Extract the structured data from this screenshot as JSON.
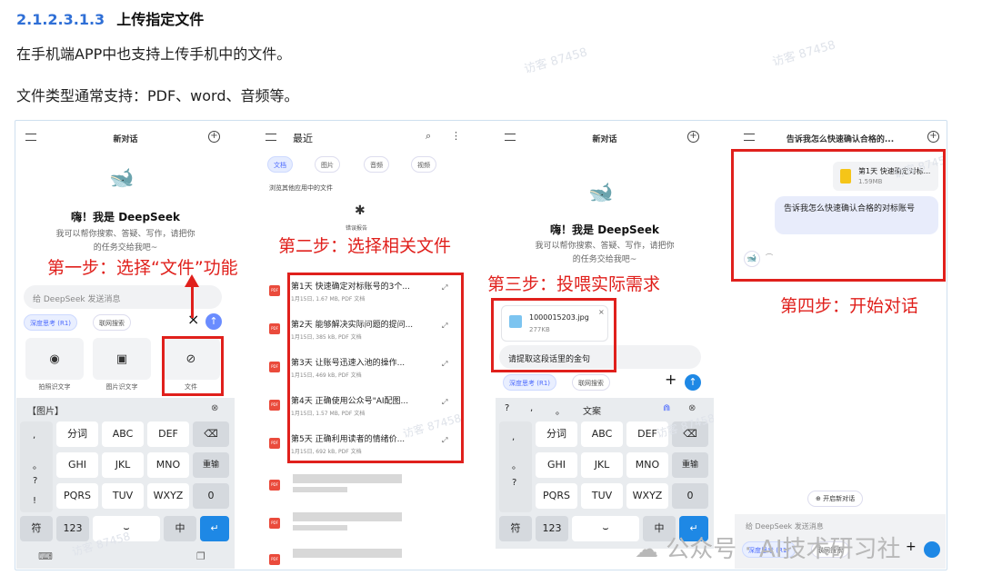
{
  "section": {
    "number": "2.1.2.3.1.3",
    "title": "上传指定文件",
    "para1": "在手机端APP中也支持上传手机中的文件。",
    "para2": "文件类型通常支持：PDF、word、音频等。"
  },
  "watermark": "访客 87458",
  "screen1": {
    "title": "新对话",
    "greeting": "嗨！我是 DeepSeek",
    "sub1": "我可以帮你搜索、答疑、写作，请把你",
    "sub2": "的任务交给我吧~",
    "input_placeholder": "给 DeepSeek 发送消息",
    "chip_think": "深度思考 (R1)",
    "chip_search": "联网搜索",
    "close": "×",
    "tiles": [
      {
        "icon": "camera-icon",
        "glyph": "◉",
        "label": "拍照识文字"
      },
      {
        "icon": "image-icon",
        "glyph": "▣",
        "label": "图片识文字"
      },
      {
        "icon": "paperclip-icon",
        "glyph": "⊘",
        "label": "文件"
      }
    ],
    "kb_top": "【图片】",
    "kb_rows": [
      [
        ",",
        "分词",
        "ABC",
        "DEF",
        "⌫"
      ],
      [
        "。",
        "GHI",
        "JKL",
        "MNO",
        "重输"
      ],
      [
        "?",
        "PQRS",
        "TUV",
        "WXYZ",
        "0"
      ],
      [
        "!",
        "",
        "",
        "",
        ""
      ]
    ],
    "kb_bottom": [
      "符",
      "123",
      "⌣",
      "中",
      "↵"
    ],
    "step": "第一步：选择“文件”功能"
  },
  "screen2": {
    "title": "最近",
    "tabs": [
      "文档",
      "图片",
      "音频",
      "视频"
    ],
    "section_label": "浏览其他应用中的文件",
    "bug_label": "错误报告",
    "files": [
      {
        "name": "第1天 快速确定对标账号的3个...",
        "meta": "1月15日, 1.67 MB, PDF 文档"
      },
      {
        "name": "第2天 能够解决实际问题的提问...",
        "meta": "1月15日, 385 kB, PDF 文档"
      },
      {
        "name": "第3天 让账号迅速入池的操作...",
        "meta": "1月15日, 469 kB, PDF 文档"
      },
      {
        "name": "第4天  正确使用公众号\"AI配图...",
        "meta": "1月15日, 1.57 MB, PDF 文档"
      },
      {
        "name": "第5天  正确利用读者的情绪价...",
        "meta": "1月15日, 692 kB, PDF 文档"
      }
    ],
    "step": "第二步：选择相关文件"
  },
  "screen3": {
    "title": "新对话",
    "greeting": "嗨！我是 DeepSeek",
    "sub1": "我可以帮你搜索、答疑、写作，请把你",
    "sub2": "的任务交给我吧~",
    "file_name": "1000015203.jpg",
    "file_size": "277KB",
    "prompt": "请提取这段话里的金句",
    "chip_think": "深度思考 (R1)",
    "chip_search": "联网搜索",
    "kb_top_left": [
      "?",
      ",",
      "。"
    ],
    "kb_top_mid": "文案",
    "kb_rows": [
      [
        ",",
        "分词",
        "ABC",
        "DEF",
        "⌫"
      ],
      [
        "。",
        "GHI",
        "JKL",
        "MNO",
        "重输"
      ],
      [
        "?",
        "PQRS",
        "TUV",
        "WXYZ",
        "0"
      ]
    ],
    "kb_bottom": [
      "符",
      "123",
      "⌣",
      "中",
      "↵"
    ],
    "step": "第三步：投喂实际需求"
  },
  "screen4": {
    "title": "告诉我怎么快速确认合格的...",
    "file_name": "第1天 快速确定对标...",
    "file_size": "1.59MB",
    "message": "告诉我怎么快速确认合格的对标账号",
    "new_chat": "开启新对话",
    "input_placeholder": "给 DeepSeek 发送消息",
    "chip_think": "深度思考 (R1)",
    "chip_search": "联网搜索",
    "step": "第四步：开始对话"
  },
  "footer_watermark": "公众号 · AI技术研习社",
  "colors": {
    "red": "#e0201c",
    "blue": "#4d6bfe",
    "heading_blue": "#2f6fd6"
  }
}
